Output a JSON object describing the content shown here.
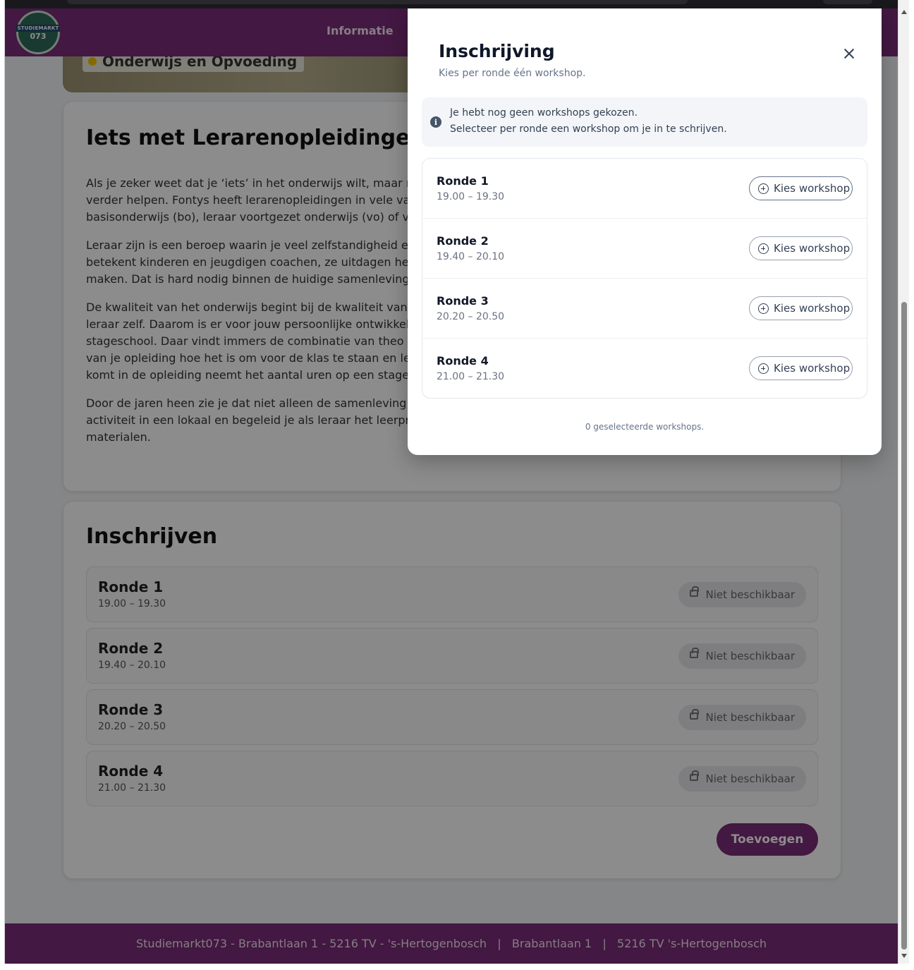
{
  "header": {
    "logo_line1": "STUDIEMARKT",
    "logo_line2": "073",
    "nav_informatie": "Informatie"
  },
  "hero": {
    "tag": "Onderwijs en Opvoeding"
  },
  "article": {
    "title": "Iets met Lerarenopleidingen e",
    "paragraphs": [
      [
        "Als je zeker weet dat je ‘iets’ in het onderwijs wilt, maar no",
        "verder helpen. Fontys heeft lerarenopleidingen in vele va",
        "basisonderwijs (bo), leraar voortgezet onderwijs (vo) of v"
      ],
      [
        "Leraar zijn is een beroep waarin je veel zelfstandigheid e",
        "betekent kinderen en jeugdigen coachen, ze uitdagen he",
        "maken. Dat is hard nodig binnen de huidige samenleving"
      ],
      [
        "De kwaliteit van het onderwijs begint bij de kwaliteit van",
        "leraar zelf. Daarom is er voor jouw persoonlijke ontwikkeli",
        "stageschool. Daar vindt immers de combinatie van theo",
        "van je opleiding hoe het is om voor de klas te staan en le",
        "komt in de opleiding neemt het aantal uren op een stage"
      ],
      [
        "Door de jaren heen zie je dat niet alleen de samenleving,",
        "activiteit in een lokaal en begeleid je als leraar het leerpr",
        "materialen."
      ]
    ]
  },
  "signup": {
    "title": "Inschrijven",
    "rounds": [
      {
        "name": "Ronde 1",
        "time": "19.00 – 19.30",
        "status": "Niet beschikbaar"
      },
      {
        "name": "Ronde 2",
        "time": "19.40 – 20.10",
        "status": "Niet beschikbaar"
      },
      {
        "name": "Ronde 3",
        "time": "20.20 – 20.50",
        "status": "Niet beschikbaar"
      },
      {
        "name": "Ronde 4",
        "time": "21.00 – 21.30",
        "status": "Niet beschikbaar"
      }
    ],
    "add_label": "Toevoegen"
  },
  "footer": {
    "text": "Studiemarkt073 - Brabantlaan 1 - 5216 TV - 's-Hertogenbosch   |   Brabantlaan 1   |   5216 TV 's-Hertogenbosch"
  },
  "modal": {
    "title": "Inschrijving",
    "subtitle": "Kies per ronde één workshop.",
    "info_line1": "Je hebt nog geen workshops gekozen.",
    "info_line2": "Selecteer per ronde een workshop om je in te schrijven.",
    "rounds": [
      {
        "name": "Ronde 1",
        "time": "19.00 – 19.30",
        "button": "Kies workshop"
      },
      {
        "name": "Ronde 2",
        "time": "19.40 – 20.10",
        "button": "Kies workshop"
      },
      {
        "name": "Ronde 3",
        "time": "20.20 – 20.50",
        "button": "Kies workshop"
      },
      {
        "name": "Ronde 4",
        "time": "21.00 – 21.30",
        "button": "Kies workshop"
      }
    ],
    "count": "0 geselecteerde workshops."
  },
  "colors": {
    "brand": "#7b2d78",
    "accent_dot": "#f2c200"
  }
}
